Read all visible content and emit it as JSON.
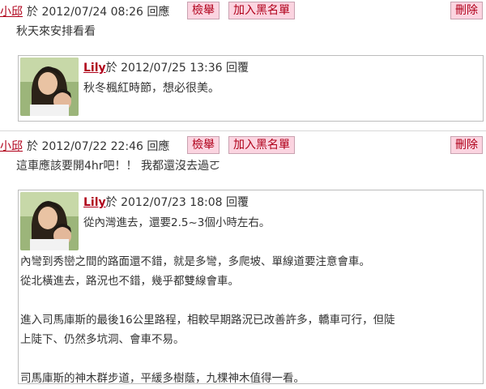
{
  "comments": [
    {
      "author": "小邱",
      "meta": "於 2012/07/24 08:26 回應",
      "report_label": "檢舉",
      "blacklist_label": "加入黑名單",
      "delete_label": "刪除",
      "text": "秋天來安排看看",
      "reply": {
        "author": "Lily",
        "meta": "於 2012/07/25 13:36 回覆",
        "paragraphs": [
          "秋冬楓紅時節，想必很美。"
        ]
      }
    },
    {
      "author": "小邱",
      "meta": "於 2012/07/22 22:46 回應",
      "report_label": "檢舉",
      "blacklist_label": "加入黑名單",
      "delete_label": "刪除",
      "text": "這車應該要開4hr吧！！ 我都還沒去過ㄛ",
      "reply": {
        "author": "Lily",
        "meta": "於 2012/07/23 18:08 回覆",
        "paragraphs": [
          "從內灣進去，還要2.5~3個小時左右。",
          "",
          "內彎到秀巒之間的路面還不錯，就是多彎，多爬坡、單線道要注意會車。",
          "從北橫進去，路況也不錯，幾乎都雙線會車。",
          "",
          "進入司馬庫斯的最後16公里路程，相較早期路況已改善許多，轎車可行，但陡",
          "上陡下、仍然多坑洞、會車不易。",
          "",
          "司馬庫斯的神木群步道，平緩多樹蔭，九棵神木值得一看。"
        ]
      }
    }
  ]
}
